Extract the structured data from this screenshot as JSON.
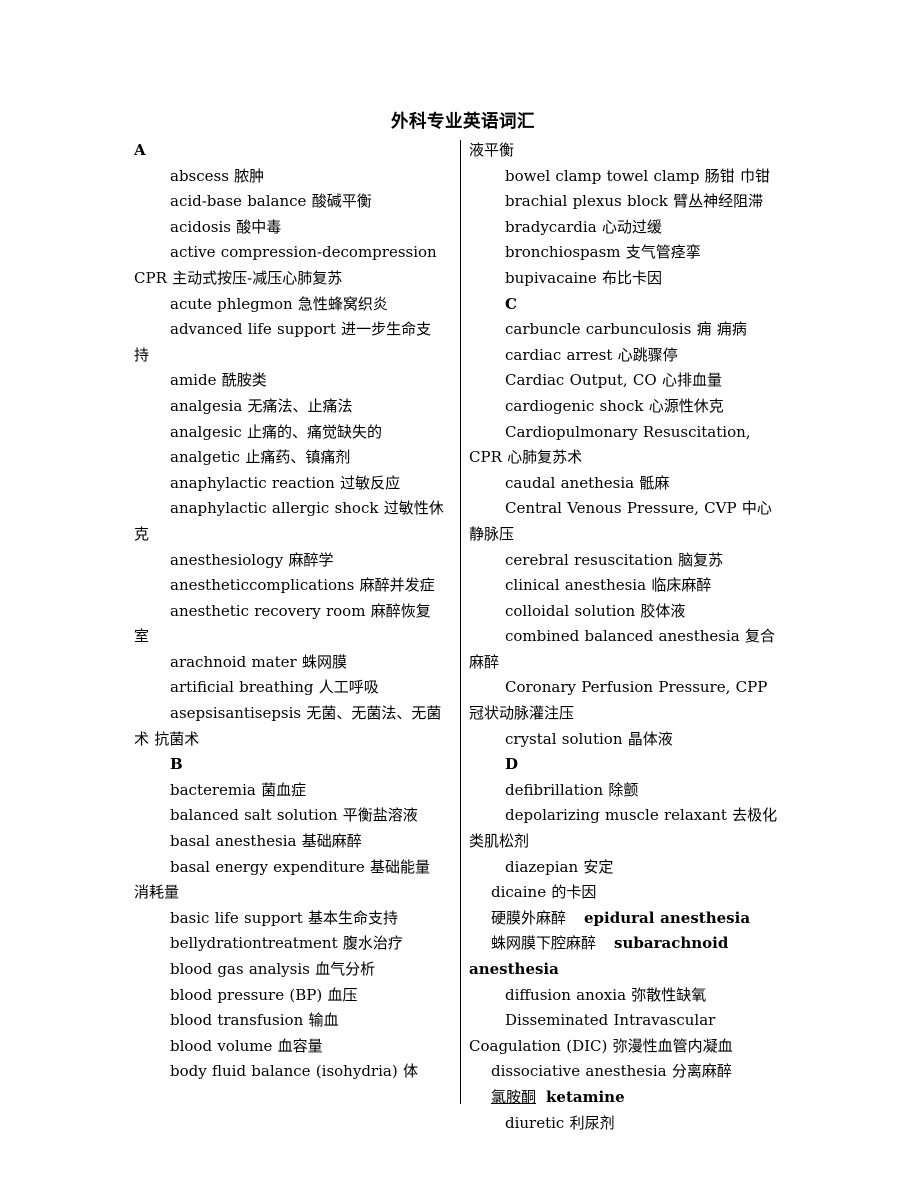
{
  "document": {
    "title": "外科专业英语词汇",
    "background_color": "#ffffff",
    "text_color": "#000000"
  },
  "left_column": {
    "section_a_heading": "A",
    "section_b_heading": "B",
    "entries": [
      {
        "id": "abscess",
        "en": "abscess",
        "cn": "脓肿",
        "line": "abscess   脓肿"
      },
      {
        "id": "acid-base-balance",
        "en": "acid-base balance",
        "cn": "酸碱平衡",
        "line": "acid-base balance   酸碱平衡"
      },
      {
        "id": "acidosis",
        "en": "acidosis",
        "cn": "酸中毒",
        "line": "acidosis  酸中毒"
      },
      {
        "id": "active-compression-decompression-cpr",
        "en": "active compression-decompression CPR",
        "cn": "主动式按压-减压心肺复苏",
        "line": "active compression-decompression CPR  主动式按压-减压心肺复苏"
      },
      {
        "id": "acute-phlegmon",
        "en": "acute phlegmon",
        "cn": "急性蜂窝织炎",
        "line": "acute phlegmon  急性蜂窝织炎"
      },
      {
        "id": "advanced-life-support",
        "en": "advanced life support",
        "cn": "进一步生命支持",
        "line": "advanced life support   进一步生命支持"
      },
      {
        "id": "amide",
        "en": "amide",
        "cn": "酰胺类",
        "line": "amide  酰胺类"
      },
      {
        "id": "analgesia",
        "en": "analgesia",
        "cn": "无痛法、止痛法",
        "line": "analgesia   无痛法、止痛法"
      },
      {
        "id": "analgesic",
        "en": "analgesic",
        "cn": "止痛的、痛觉缺失的",
        "line": "analgesic   止痛的、痛觉缺失的"
      },
      {
        "id": "analgetic",
        "en": "analgetic",
        "cn": "止痛药、镇痛剂",
        "line": "analgetic  止痛药、镇痛剂"
      },
      {
        "id": "anaphylactic-reaction",
        "en": "anaphylactic reaction",
        "cn": "过敏反应",
        "line": "anaphylactic reaction   过敏反应"
      },
      {
        "id": "anaphylactic-allergic-shock",
        "en": "anaphylactic allergic shock",
        "cn": "过敏性休克",
        "line": "anaphylactic allergic shock   过敏性休克"
      },
      {
        "id": "anesthesiology",
        "en": "anesthesiology",
        "cn": "麻醉学",
        "line": "anesthesiology   麻醉学"
      },
      {
        "id": "anestheticcomplications",
        "en": "anestheticcomplications",
        "cn": "麻醉并发症",
        "line": "anestheticcomplications  麻醉并发症"
      },
      {
        "id": "anesthetic-recovery-room",
        "en": "anesthetic recovery room",
        "cn": "麻醉恢复室",
        "line": "anesthetic recovery room  麻醉恢复室"
      },
      {
        "id": "arachnoid-mater",
        "en": "arachnoid mater",
        "cn": "蛛网膜",
        "line": "arachnoid mater  蛛网膜"
      },
      {
        "id": "artificial-breathing",
        "en": "artificial breathing",
        "cn": "人工呼吸",
        "line": "artificial breathing   人工呼吸"
      },
      {
        "id": "asepsisantisepsis",
        "en": "asepsisantisepsis",
        "cn": "无菌、无菌法、无菌术 抗菌术",
        "line": "asepsisantisepsis 无菌、无菌法、无菌术 抗菌术"
      },
      {
        "id": "bacteremia",
        "en": "bacteremia",
        "cn": "菌血症",
        "line": "bacteremia   菌血症"
      },
      {
        "id": "balanced-salt-solution",
        "en": "balanced salt solution",
        "cn": "平衡盐溶液",
        "line": "balanced salt solution 平衡盐溶液"
      },
      {
        "id": "basal-anesthesia",
        "en": "basal anesthesia",
        "cn": "基础麻醉",
        "line": "basal anesthesia  基础麻醉"
      },
      {
        "id": "basal-energy-expenditure",
        "en": "basal energy expenditure",
        "cn": "基础能量消耗量",
        "line": "basal energy expenditure 基础能量消耗量"
      },
      {
        "id": "basic-life-support",
        "en": "basic life support",
        "cn": "基本生命支持",
        "line": "basic life support  基本生命支持"
      },
      {
        "id": "bellydrationtreatment",
        "en": "bellydrationtreatment",
        "cn": "腹水治疗",
        "line": "bellydrationtreatment 腹水治疗"
      },
      {
        "id": "blood-gas-analysis",
        "en": "blood gas analysis",
        "cn": "血气分析",
        "line": "blood gas analysis 血气分析"
      },
      {
        "id": "blood-pressure",
        "en": "blood pressure (BP)",
        "cn": "血压",
        "line": "blood pressure (BP) 血压"
      },
      {
        "id": "blood-transfusion",
        "en": "blood transfusion",
        "cn": "输血",
        "line": "blood transfusion  输血"
      },
      {
        "id": "blood-volume",
        "en": "blood volume",
        "cn": "血容量",
        "line": "blood volume  血容量"
      },
      {
        "id": "body-fluid-balance",
        "en": "body fluid balance (isohydria)",
        "cn": "体",
        "line": "body fluid balance (isohydria) 体"
      }
    ]
  },
  "right_column": {
    "continuation_line": "液平衡",
    "section_c_heading": "C",
    "section_d_heading": "D",
    "entries": [
      {
        "id": "bowel-clamp-towel-clamp",
        "en": "bowel clamp towel clamp",
        "cn": "肠钳 巾钳",
        "line": "bowel clamp towel clamp  肠钳 巾钳"
      },
      {
        "id": "brachial-plexus-block",
        "en": "brachial plexus block",
        "cn": "臂丛神经阻滞",
        "line": "brachial plexus block   臂丛神经阻滞"
      },
      {
        "id": "bradycardia",
        "en": "bradycardia",
        "cn": "心动过缓",
        "line": "bradycardia   心动过缓"
      },
      {
        "id": "bronchiospasm",
        "en": "bronchiospasm",
        "cn": "支气管痉挛",
        "line": "bronchiospasm   支气管痉挛"
      },
      {
        "id": "bupivacaine",
        "en": "bupivacaine",
        "cn": "布比卡因",
        "line": "bupivacaine 布比卡因"
      },
      {
        "id": "carbuncle-carbunculosis",
        "en": "carbuncle carbunculosis",
        "cn": "痈 痈病",
        "line": "carbuncle carbunculosis 痈 痈病"
      },
      {
        "id": "cardiac-arrest",
        "en": "cardiac arrest",
        "cn": "心跳骤停",
        "line": "cardiac arrest   心跳骤停"
      },
      {
        "id": "cardiac-output",
        "en": "Cardiac Output, CO",
        "cn": "心排血量",
        "line": "Cardiac Output, CO  心排血量"
      },
      {
        "id": "cardiogenic-shock",
        "en": "cardiogenic shock",
        "cn": "心源性休克",
        "line": "cardiogenic shock  心源性休克"
      },
      {
        "id": "cardiopulmonary-resuscitation",
        "en": "Cardiopulmonary Resuscitation, CPR",
        "cn": "心肺复苏术",
        "line": "Cardiopulmonary Resuscitation, CPR  心肺复苏术"
      },
      {
        "id": "caudal-anethesia",
        "en": "caudal anethesia",
        "cn": "骶麻",
        "line": "caudal anethesia  骶麻"
      },
      {
        "id": "central-venous-pressure",
        "en": "Central Venous Pressure, CVP",
        "cn": "中心静脉压",
        "line": "Central Venous Pressure, CVP 中心静脉压"
      },
      {
        "id": "cerebral-resuscitation",
        "en": "cerebral resuscitation",
        "cn": "脑复苏",
        "line": "cerebral resuscitation 脑复苏"
      },
      {
        "id": "clinical-anesthesia",
        "en": "clinical anesthesia",
        "cn": "临床麻醉",
        "line": "clinical anesthesia 临床麻醉"
      },
      {
        "id": "colloidal-solution",
        "en": "colloidal solution",
        "cn": "胶体液",
        "line": "colloidal solution  胶体液"
      },
      {
        "id": "combined-balanced-anesthesia",
        "en": "combined balanced anesthesia",
        "cn": "复合麻醉",
        "line": "combined balanced anesthesia 复合麻醉"
      },
      {
        "id": "coronary-perfusion-pressure",
        "en": "Coronary Perfusion Pressure, CPP",
        "cn": "冠状动脉灌注压",
        "line": "Coronary Perfusion Pressure, CPP 冠状动脉灌注压"
      },
      {
        "id": "crystal-solution",
        "en": "crystal solution",
        "cn": "晶体液",
        "line": "crystal solution   晶体液"
      },
      {
        "id": "defibrillation",
        "en": "defibrillation",
        "cn": "除颤",
        "line": "defibrillation  除颤"
      },
      {
        "id": "depolarizing-muscle-relaxant",
        "en": "depolarizing muscle relaxant",
        "cn": "去极化类肌松剂",
        "line": "depolarizing muscle relaxant 去极化类肌松剂"
      },
      {
        "id": "diazepian",
        "en": "diazepian",
        "cn": "安定",
        "line": "diazepian  安定"
      },
      {
        "id": "dicaine",
        "en": "dicaine",
        "cn": "的卡因",
        "line": "dicaine 的卡因"
      },
      {
        "id": "epidural-anesthesia",
        "en": "epidural anesthesia",
        "cn": "硬膜外麻醉",
        "line": "硬膜外麻醉   epidural anesthesia",
        "cn_first": true,
        "en_bold": true
      },
      {
        "id": "subarachnoid-anesthesia",
        "en": "subarachnoid anesthesia",
        "cn": "蛛网膜下腔麻醉",
        "line": "蛛网膜下腔麻醉   subarachnoid anesthesia",
        "cn_first": true,
        "en_bold": true
      },
      {
        "id": "diffusion-anoxia",
        "en": "diffusion anoxia",
        "cn": "弥散性缺氧",
        "line": "diffusion anoxia 弥散性缺氧"
      },
      {
        "id": "disseminated-intravascular-coagulation",
        "en": "Disseminated Intravascular Coagulation (DIC)",
        "cn": "弥漫性血管内凝血",
        "line": "Disseminated Intravascular Coagulation (DIC) 弥漫性血管内凝血"
      },
      {
        "id": "dissociative-anesthesia",
        "en": "dissociative anesthesia",
        "cn": "分离麻醉",
        "line": "dissociative anesthesia 分离麻醉"
      },
      {
        "id": "ketamine",
        "en": "ketamine",
        "cn": "氯胺酮",
        "line": "氯胺酮  ketamine",
        "cn_first": true,
        "en_bold": true,
        "cn_underline": true
      },
      {
        "id": "diuretic",
        "en": "diuretic",
        "cn": "利尿剂",
        "line": "diuretic   利尿剂"
      }
    ]
  }
}
